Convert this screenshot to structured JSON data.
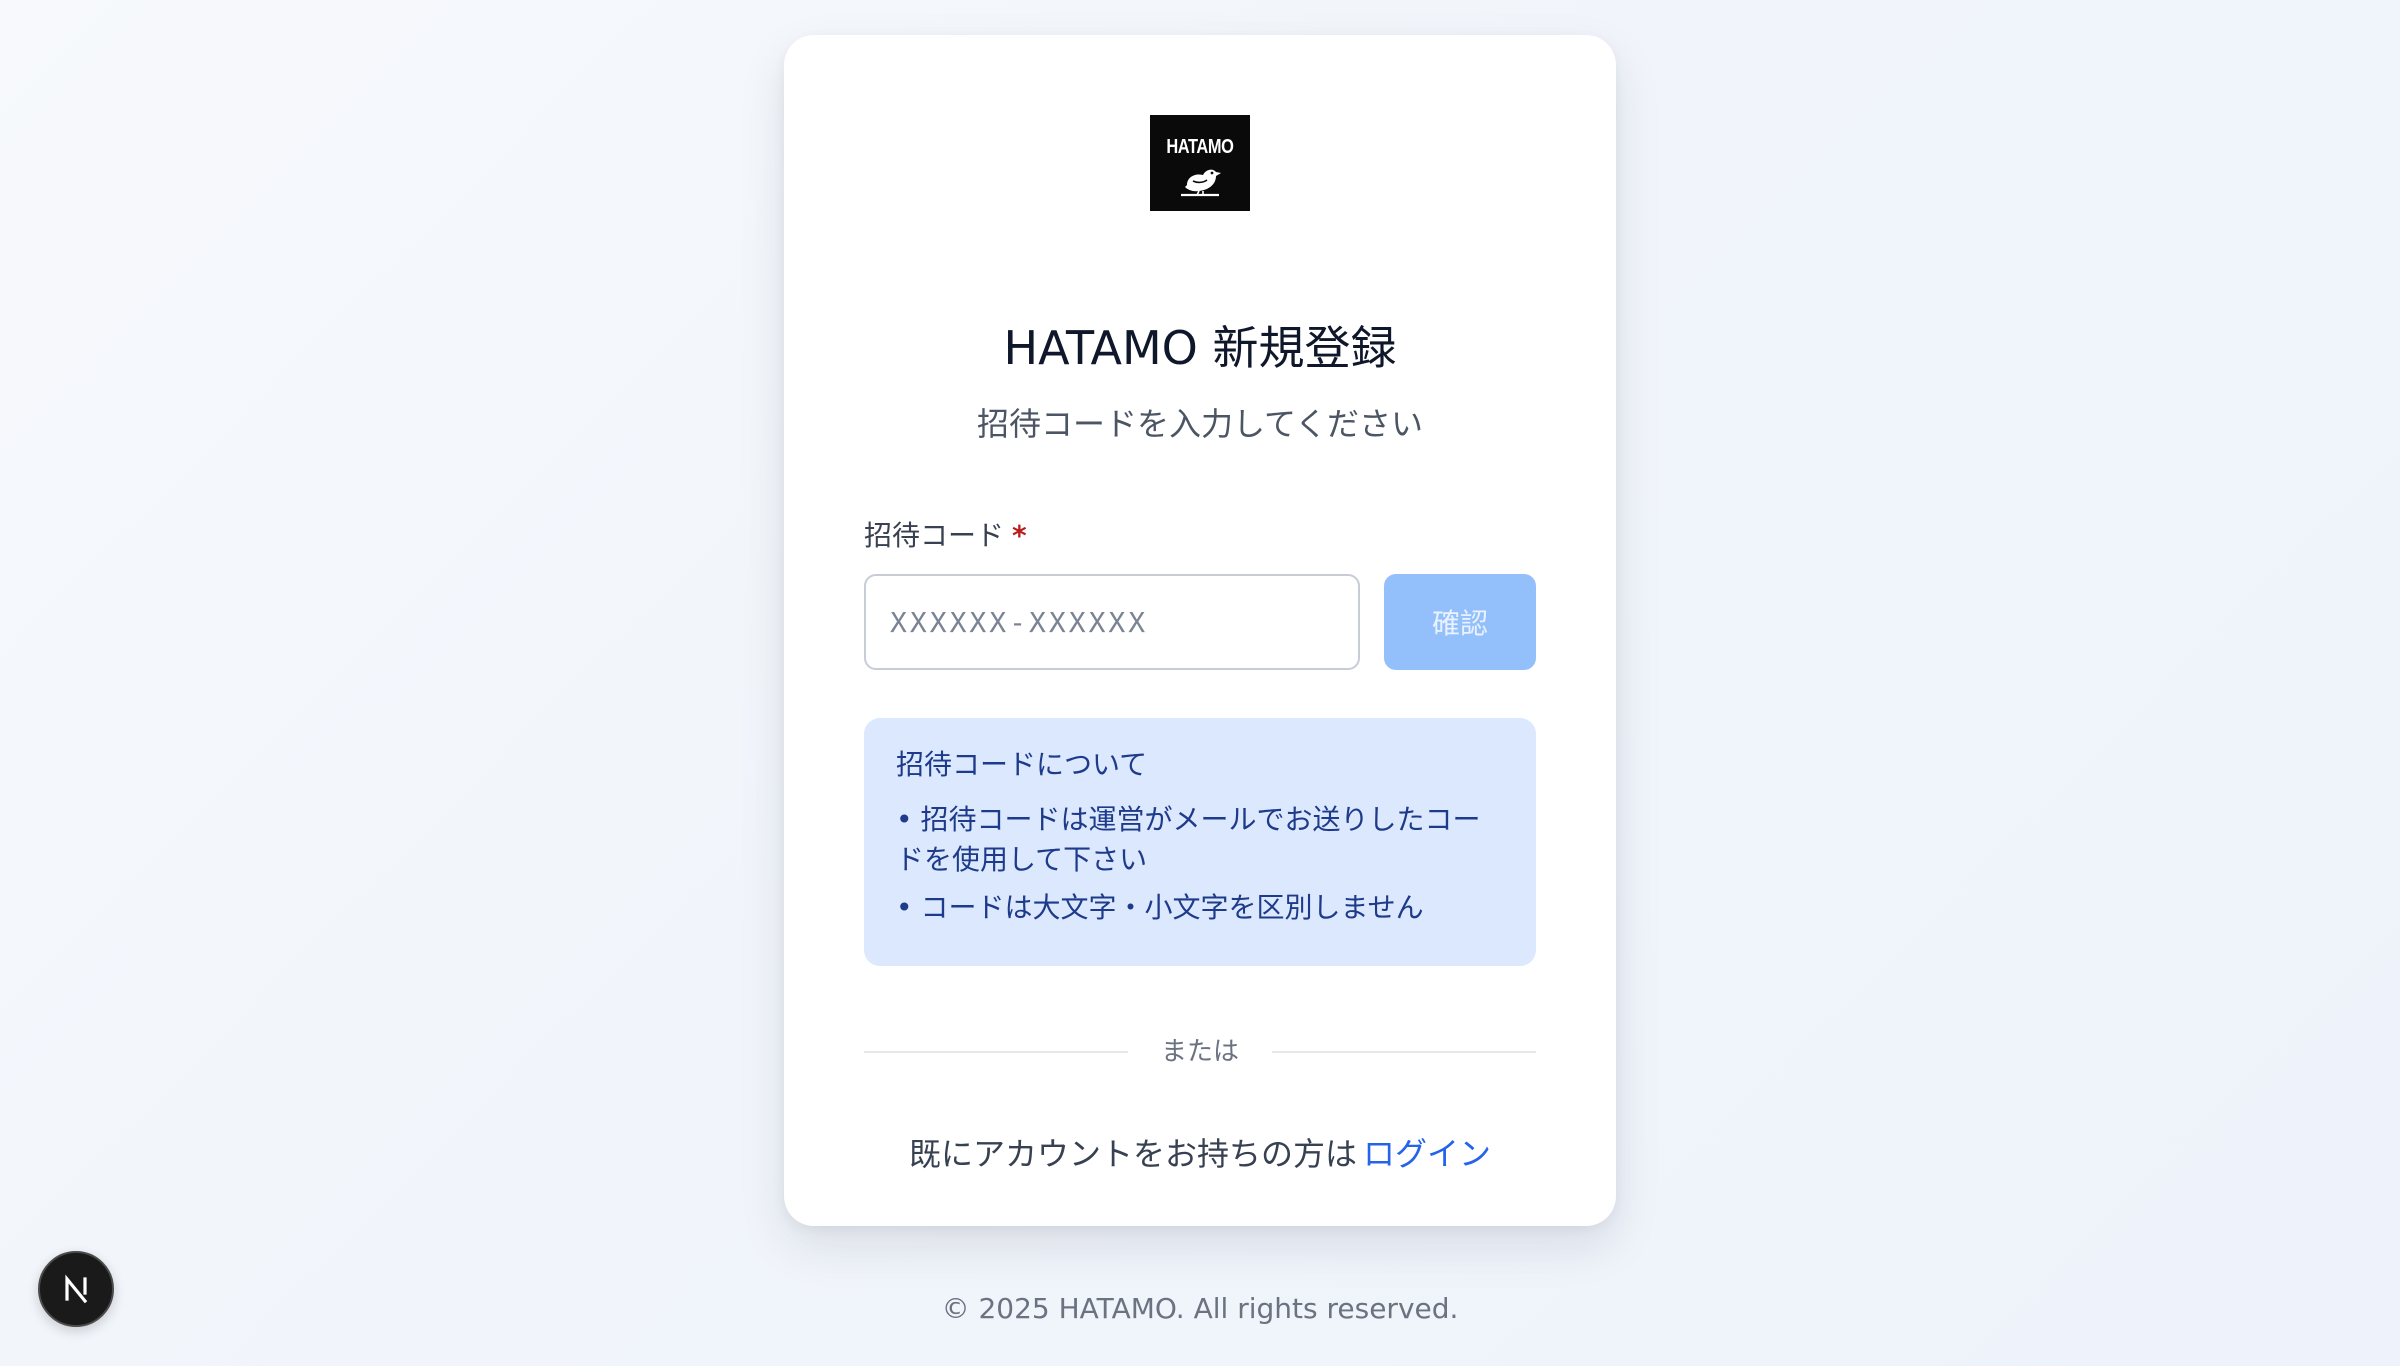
{
  "logo": {
    "text": "HATAMO",
    "icon": "bird-logo-icon"
  },
  "header": {
    "title": "HATAMO 新規登録",
    "subtitle": "招待コードを入力してください"
  },
  "form": {
    "label": "招待コード",
    "required_mark": "*",
    "placeholder": "XXXXXX-XXXXXX",
    "value": "",
    "confirm_label": "確認"
  },
  "info": {
    "title": "招待コードについて",
    "bullet": "•",
    "items": [
      "招待コードは運営がメールでお送りしたコードを使用して下さい",
      "コードは大文字・小文字を区別しません"
    ]
  },
  "divider": {
    "text": "または"
  },
  "login": {
    "prompt": "既にアカウントをお持ちの方は",
    "link": "ログイン"
  },
  "footer": {
    "text": "© 2025 HATAMO. All rights reserved."
  },
  "dev_badge": {
    "icon": "nextjs-n-icon",
    "letter": "N"
  },
  "colors": {
    "accent": "#2563eb",
    "button_disabled": "#93c0fb",
    "info_bg": "#dbe8fe",
    "info_text": "#1e3a8a",
    "required": "#b91c1c"
  }
}
